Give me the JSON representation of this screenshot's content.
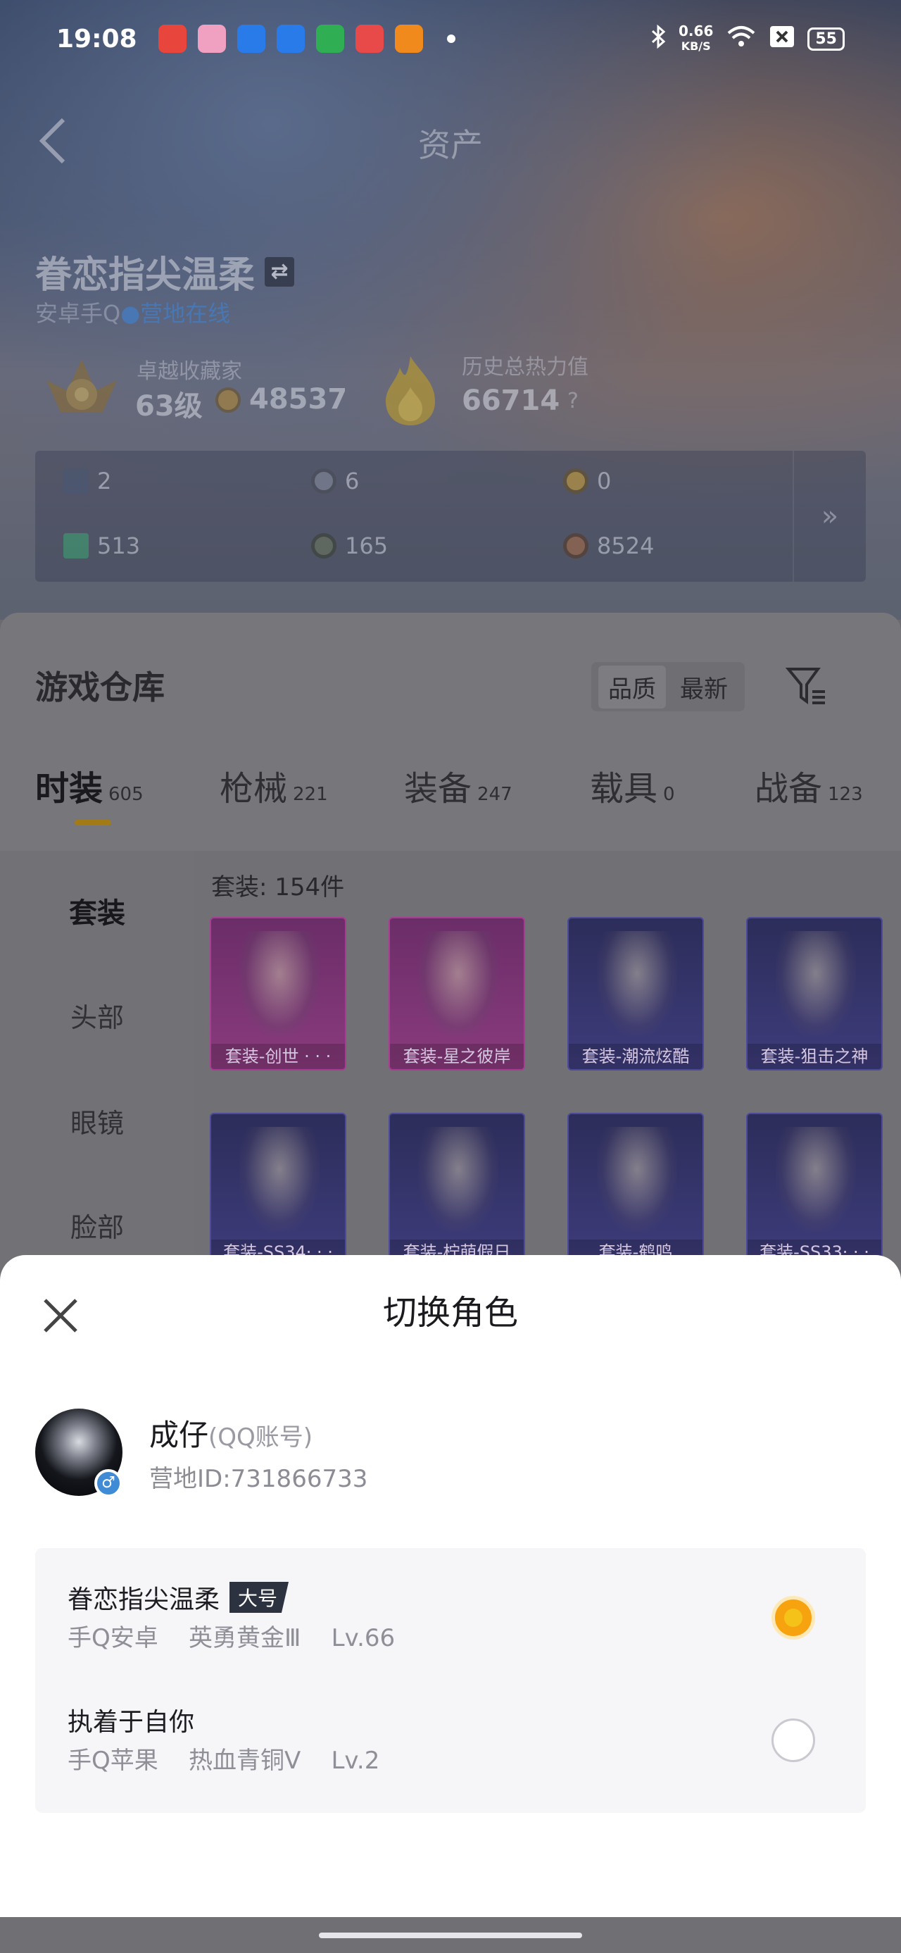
{
  "status_bar": {
    "time": "19:08",
    "net_speed_value": "0.66",
    "net_speed_unit": "KB/S",
    "battery": "55",
    "app_icon_colors": [
      "#e8463c",
      "#f0a0c0",
      "#2a7bea",
      "#2a7bea",
      "#2fae54",
      "#e84a4a",
      "#f08a1c"
    ]
  },
  "header": {
    "title": "资产",
    "back_icon": "chevron-left-icon"
  },
  "player": {
    "name": "眷恋指尖温柔",
    "platform": "安卓手Q",
    "online_status": "营地在线",
    "collector_label": "卓越收藏家",
    "collector_level": "63级",
    "collector_points": "48537",
    "heat_label": "历史总热力值",
    "heat_value": "66714",
    "help_mark": "?"
  },
  "currencies": [
    {
      "icon": "card-icon",
      "value": "2"
    },
    {
      "icon": "coin-silver-icon",
      "value": "6"
    },
    {
      "icon": "coin-gold-icon",
      "value": "0"
    },
    {
      "icon": "card-green-icon",
      "value": "513"
    },
    {
      "icon": "coin-dark-icon",
      "value": "165"
    },
    {
      "icon": "coin-bronze-icon",
      "value": "8524"
    }
  ],
  "warehouse": {
    "title": "游戏仓库",
    "sort_options": [
      "品质",
      "最新"
    ],
    "tabs": [
      {
        "label": "时装",
        "count": "605"
      },
      {
        "label": "枪械",
        "count": "221"
      },
      {
        "label": "装备",
        "count": "247"
      },
      {
        "label": "载具",
        "count": "0"
      },
      {
        "label": "战备",
        "count": "123"
      }
    ],
    "categories": [
      "套装",
      "头部",
      "眼镜",
      "脸部"
    ],
    "suit_count": "套装: 154件",
    "items": [
      {
        "label": "套装-创世 · · ·",
        "rarity": "pink"
      },
      {
        "label": "套装-星之彼岸",
        "rarity": "pink"
      },
      {
        "label": "套装-潮流炫酷",
        "rarity": "blue"
      },
      {
        "label": "套装-狙击之神",
        "rarity": "blue"
      },
      {
        "label": "套装-SS34· · ·",
        "rarity": "blue"
      },
      {
        "label": "套装-柠萌假日",
        "rarity": "blue"
      },
      {
        "label": "套装-鹤鸣",
        "rarity": "blue"
      },
      {
        "label": "套装-SS33· · ·",
        "rarity": "blue"
      }
    ]
  },
  "sheet": {
    "title": "切换角色",
    "account": {
      "name": "成仔",
      "type": "(QQ账号)",
      "camp_id": "营地ID:731866733",
      "gender_icon": "male-icon"
    },
    "roles": [
      {
        "name": "眷恋指尖温柔",
        "badge": "大号",
        "meta": "手Q安卓    英勇黄金Ⅲ    Lv.66",
        "selected": true
      },
      {
        "name": "执着于自你",
        "badge": "",
        "meta": "手Q苹果    热血青铜Ⅴ    Lv.2",
        "selected": false
      }
    ]
  },
  "colors": {
    "accent_orange": "#f7a20f",
    "online_blue": "#3a88e0",
    "tab_indicator": "#a27a16"
  }
}
